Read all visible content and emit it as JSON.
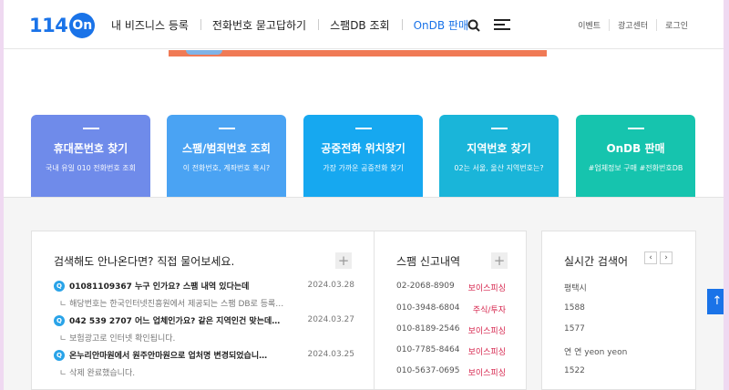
{
  "header": {
    "logo_number": "114",
    "logo_on": "On",
    "nav": [
      {
        "label": "내 비즈니스 등록"
      },
      {
        "label": "전화번호 묻고답하기"
      },
      {
        "label": "스팸DB 조회"
      },
      {
        "label": "OnDB 판매"
      }
    ],
    "utility": [
      "이벤트",
      "광고센터",
      "로그인"
    ]
  },
  "cards": [
    {
      "title": "휴대폰번호 찾기",
      "sub": "국내 유일 010 전화번호 조회",
      "color": "#6f8bea"
    },
    {
      "title": "스팸/범죄번호 조회",
      "sub": "이 전화번호, 계좌번호 혹시?",
      "color": "#4aa3f3"
    },
    {
      "title": "공중전화 위치찾기",
      "sub": "가장 가까운 공중전화 찾기",
      "color": "#16a8f0"
    },
    {
      "title": "지역번호 찾기",
      "sub": "02는 서울, 울산 지역번호는?",
      "color": "#1ab5d9"
    },
    {
      "title": "OnDB 판매",
      "sub": "#업체정보 구매 #전화번호DB",
      "color": "#16c4ae"
    }
  ],
  "qa": {
    "title": "검색해도 안나온다면? 직접 물어보세요.",
    "plus": "+",
    "items": [
      {
        "q": "01081109367 누구 인가요? 스팸 내역 있다는데",
        "date": "2024.03.28",
        "a": "ㄴ 해당번호는 한국인터넷진흥원에서 제공되는 스팸 DB로 등록…"
      },
      {
        "q": "042 539 2707 어느 업체인가요? 같은 지역인건 맞는데 …",
        "date": "2024.03.27",
        "a": "ㄴ 보험광고로 인터넷 확인됩니다."
      },
      {
        "q": "온누리안마원에서 원주안마원으로 업처명 변경되었습니…",
        "date": "2024.03.25",
        "a": "ㄴ 삭제 완료했습니다."
      }
    ]
  },
  "spam": {
    "title": "스팸 신고내역",
    "plus": "+",
    "items": [
      {
        "num": "02-2068-8909",
        "type": "보이스피싱"
      },
      {
        "num": "010-3948-6804",
        "type": "주식/투자"
      },
      {
        "num": "010-8189-2546",
        "type": "보이스피싱"
      },
      {
        "num": "010-7785-8464",
        "type": "보이스피싱"
      },
      {
        "num": "010-5637-0695",
        "type": "보이스피싱"
      }
    ]
  },
  "realtime": {
    "title": "실시간 검색어",
    "prev": "‹",
    "next": "›",
    "items": [
      "평택시",
      "1588",
      "1577",
      "연 연 yeon yeon",
      "1522"
    ]
  },
  "top_button": "↑"
}
